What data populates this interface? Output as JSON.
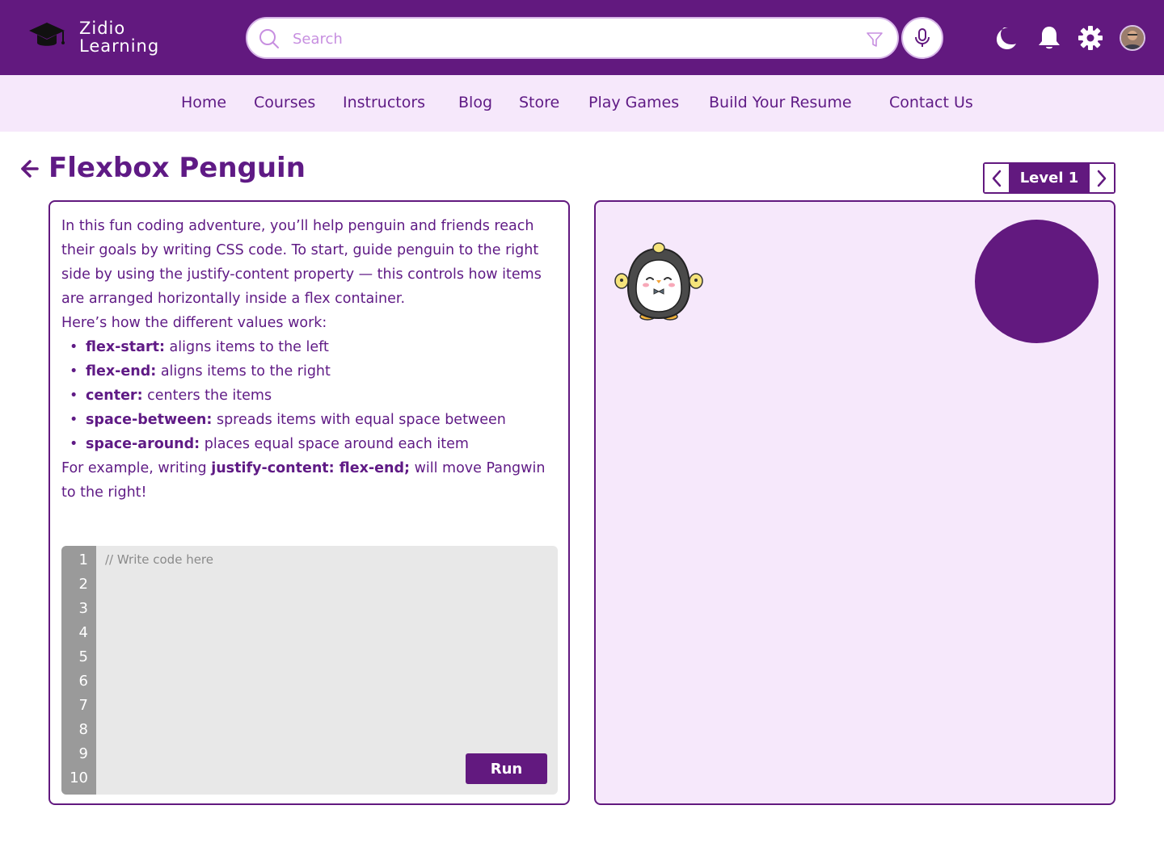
{
  "brand": {
    "line1": "Zidio",
    "line2": "Learning"
  },
  "search": {
    "placeholder": "Search"
  },
  "nav": [
    "Home",
    "Courses",
    "Instructors",
    "Blog",
    "Store",
    "Play Games",
    "Build Your Resume",
    "Contact Us"
  ],
  "page": {
    "title": "Flexbox Penguin"
  },
  "level": {
    "label": "Level 1"
  },
  "instructions": {
    "intro": "In this fun coding adventure, you’ll help penguin and friends reach their goals by writing CSS code. To start, guide penguin to the right side by using the justify-content property — this controls how items are arranged horizontally inside a flex container.",
    "values_heading": "Here’s how the different values work:",
    "values": [
      {
        "term": "flex-start:",
        "desc": " aligns items to the left"
      },
      {
        "term": "flex-end:",
        "desc": " aligns items to the right"
      },
      {
        "term": "center:",
        "desc": " centers the items"
      },
      {
        "term": "space-between:",
        "desc": " spreads items with equal space between"
      },
      {
        "term": "space-around:",
        "desc": " places equal space around each item"
      }
    ],
    "example_pre": "For example, writing ",
    "example_code": "justify-content: flex-end;",
    "example_post": " will move Pangwin to the right!"
  },
  "editor": {
    "placeholder": "// Write code here",
    "line_numbers": [
      "1",
      "2",
      "3",
      "4",
      "5",
      "6",
      "7",
      "8",
      "9",
      "10"
    ],
    "run_label": "Run"
  },
  "colors": {
    "primary": "#62197f",
    "nav_bg": "#f6e8fb",
    "board_bg": "#f6e8fb",
    "editor_bg": "#e8e8e8",
    "gutter_bg": "#9a9a9a"
  },
  "icons": [
    "graduation-cap-icon",
    "search-icon",
    "filter-icon",
    "microphone-icon",
    "moon-icon",
    "bell-icon",
    "gear-icon",
    "back-arrow-icon",
    "chevron-left-icon",
    "chevron-right-icon"
  ]
}
